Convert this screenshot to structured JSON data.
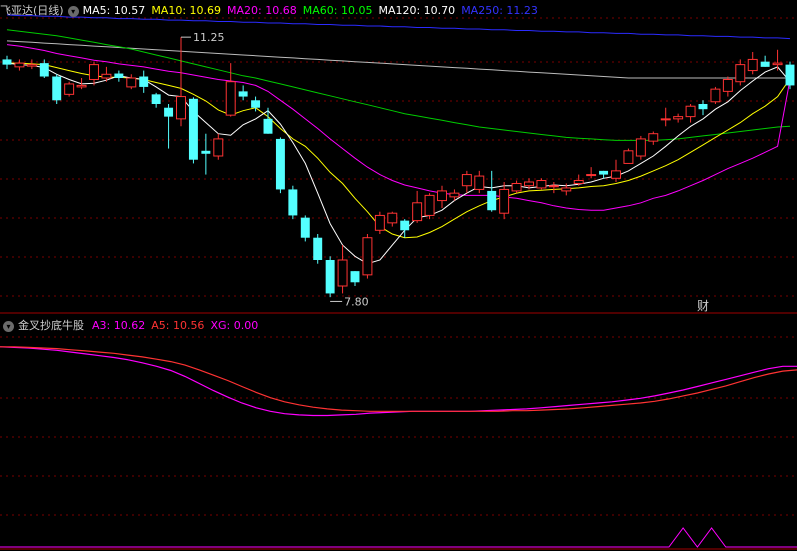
{
  "main_panel": {
    "stock_name": "飞亚达(日线)",
    "indicators": [
      {
        "label": "MA5: 10.57",
        "color": "#ffffff"
      },
      {
        "label": "MA10: 10.69",
        "color": "#ffff00"
      },
      {
        "label": "MA20: 10.68",
        "color": "#ff00ff"
      },
      {
        "label": "MA60: 10.05",
        "color": "#00ff00"
      },
      {
        "label": "MA120: 10.70",
        "color": "#ffffff"
      },
      {
        "label": "MA250: 11.23",
        "color": "#3333ff"
      }
    ],
    "high_label": "11.25",
    "low_label": "7.80",
    "finance_marker": "财"
  },
  "indicator_panel": {
    "name": "金叉抄底牛股",
    "indicators": [
      {
        "label": "A3: 10.62",
        "color": "#ff00ff"
      },
      {
        "label": "A5: 10.56",
        "color": "#ff3333"
      },
      {
        "label": "XG: 0.00",
        "color": "#ff00ff"
      }
    ]
  },
  "chart_data": [
    {
      "type": "candlestick",
      "title": "飞亚达(日线)",
      "candles": [
        [
          10.95,
          10.88,
          11.0,
          10.82
        ],
        [
          10.85,
          10.9,
          10.95,
          10.8
        ],
        [
          10.86,
          10.88,
          10.95,
          10.82
        ],
        [
          10.9,
          10.72,
          10.95,
          10.7
        ],
        [
          10.72,
          10.4,
          10.75,
          10.35
        ],
        [
          10.48,
          10.62,
          10.65,
          10.45
        ],
        [
          10.58,
          10.6,
          10.7,
          10.55
        ],
        [
          10.68,
          10.88,
          10.92,
          10.6
        ],
        [
          10.7,
          10.75,
          10.85,
          10.65
        ],
        [
          10.76,
          10.7,
          10.8,
          10.65
        ],
        [
          10.58,
          10.7,
          10.75,
          10.55
        ],
        [
          10.72,
          10.58,
          10.8,
          10.5
        ],
        [
          10.48,
          10.35,
          10.5,
          10.3
        ],
        [
          10.3,
          10.18,
          10.35,
          9.75
        ],
        [
          10.15,
          10.45,
          11.25,
          10.05
        ],
        [
          10.42,
          9.6,
          10.44,
          9.55
        ],
        [
          9.72,
          9.68,
          9.95,
          9.4
        ],
        [
          9.65,
          9.88,
          9.95,
          9.6
        ],
        [
          10.2,
          10.65,
          10.9,
          10.18
        ],
        [
          10.52,
          10.45,
          10.6,
          10.4
        ],
        [
          10.4,
          10.3,
          10.45,
          10.25
        ],
        [
          10.15,
          9.95,
          10.3,
          9.95
        ],
        [
          9.88,
          9.2,
          9.9,
          9.15
        ],
        [
          9.2,
          8.85,
          9.25,
          8.8
        ],
        [
          8.82,
          8.55,
          8.85,
          8.5
        ],
        [
          8.55,
          8.25,
          8.6,
          8.2
        ],
        [
          8.25,
          7.8,
          8.3,
          7.75
        ],
        [
          7.9,
          8.25,
          8.45,
          7.8
        ],
        [
          8.1,
          7.95,
          8.1,
          7.9
        ],
        [
          8.05,
          8.55,
          8.6,
          8.0
        ],
        [
          8.65,
          8.85,
          8.9,
          8.6
        ],
        [
          8.75,
          8.88,
          8.9,
          8.7
        ],
        [
          8.78,
          8.65,
          8.8,
          8.55
        ],
        [
          8.78,
          9.02,
          9.18,
          8.75
        ],
        [
          8.85,
          9.12,
          9.15,
          8.8
        ],
        [
          9.05,
          9.18,
          9.25,
          8.95
        ],
        [
          9.1,
          9.15,
          9.2,
          9.05
        ],
        [
          9.25,
          9.4,
          9.45,
          9.15
        ],
        [
          9.2,
          9.38,
          9.45,
          9.15
        ],
        [
          9.18,
          8.92,
          9.45,
          8.9
        ],
        [
          8.88,
          9.2,
          9.3,
          8.8
        ],
        [
          9.18,
          9.28,
          9.32,
          9.15
        ],
        [
          9.25,
          9.3,
          9.35,
          9.2
        ],
        [
          9.22,
          9.32,
          9.35,
          9.2
        ],
        [
          9.25,
          9.25,
          9.3,
          9.15
        ],
        [
          9.18,
          9.22,
          9.28,
          9.12
        ],
        [
          9.28,
          9.32,
          9.4,
          9.25
        ],
        [
          9.4,
          9.4,
          9.5,
          9.35
        ],
        [
          9.45,
          9.4,
          9.45,
          9.35
        ],
        [
          9.35,
          9.45,
          9.6,
          9.3
        ],
        [
          9.55,
          9.72,
          9.75,
          9.55
        ],
        [
          9.65,
          9.88,
          9.92,
          9.6
        ],
        [
          9.85,
          9.95,
          9.98,
          9.8
        ],
        [
          10.15,
          10.15,
          10.3,
          10.05
        ],
        [
          10.15,
          10.18,
          10.22,
          10.1
        ],
        [
          10.18,
          10.32,
          10.35,
          10.1
        ],
        [
          10.35,
          10.28,
          10.4,
          10.2
        ],
        [
          10.38,
          10.55,
          10.58,
          10.35
        ],
        [
          10.52,
          10.68,
          10.72,
          10.45
        ],
        [
          10.65,
          10.88,
          10.95,
          10.6
        ],
        [
          10.8,
          10.95,
          11.05,
          10.75
        ],
        [
          10.92,
          10.85,
          11.0,
          10.85
        ],
        [
          10.88,
          10.9,
          11.08,
          10.8
        ],
        [
          10.88,
          10.6,
          10.92,
          10.55
        ]
      ],
      "ma5": [
        10.9,
        10.88,
        10.87,
        10.84,
        10.75,
        10.68,
        10.62,
        10.63,
        10.67,
        10.73,
        10.7,
        10.68,
        10.58,
        10.47,
        10.45,
        10.25,
        10.1,
        9.95,
        9.93,
        10.07,
        10.15,
        10.26,
        10.08,
        9.83,
        9.55,
        9.15,
        8.74,
        8.45,
        8.3,
        8.2,
        8.25,
        8.45,
        8.65,
        8.82,
        8.85,
        8.92,
        9.05,
        9.15,
        9.24,
        9.22,
        9.25,
        9.25,
        9.22,
        9.24,
        9.26,
        9.25,
        9.27,
        9.3,
        9.35,
        9.38,
        9.45,
        9.55,
        9.65,
        9.78,
        9.92,
        10.05,
        10.15,
        10.28,
        10.38,
        10.53,
        10.66,
        10.78,
        10.85,
        10.65
      ],
      "ma10": [
        10.9,
        10.9,
        10.89,
        10.88,
        10.84,
        10.8,
        10.76,
        10.73,
        10.71,
        10.71,
        10.7,
        10.68,
        10.64,
        10.6,
        10.56,
        10.48,
        10.39,
        10.27,
        10.2,
        10.26,
        10.3,
        10.18,
        10.02,
        9.88,
        9.78,
        9.62,
        9.43,
        9.28,
        9.08,
        8.9,
        8.7,
        8.6,
        8.55,
        8.56,
        8.62,
        8.7,
        8.8,
        8.9,
        8.98,
        9.05,
        9.1,
        9.15,
        9.18,
        9.19,
        9.2,
        9.21,
        9.22,
        9.24,
        9.25,
        9.28,
        9.32,
        9.38,
        9.45,
        9.52,
        9.6,
        9.7,
        9.8,
        9.9,
        10.0,
        10.1,
        10.22,
        10.32,
        10.45,
        10.69
      ],
      "ma20": [
        11.15,
        11.13,
        11.1,
        11.07,
        11.03,
        11.0,
        10.97,
        10.94,
        10.92,
        10.89,
        10.87,
        10.85,
        10.82,
        10.79,
        10.77,
        10.74,
        10.71,
        10.68,
        10.66,
        10.64,
        10.6,
        10.52,
        10.4,
        10.28,
        10.15,
        10.02,
        9.88,
        9.75,
        9.62,
        9.5,
        9.4,
        9.32,
        9.26,
        9.22,
        9.18,
        9.15,
        9.13,
        9.12,
        9.12,
        9.12,
        9.1,
        9.08,
        9.05,
        9.02,
        8.98,
        8.95,
        8.93,
        8.92,
        8.92,
        8.95,
        8.98,
        9.02,
        9.08,
        9.12,
        9.18,
        9.25,
        9.32,
        9.4,
        9.48,
        9.55,
        9.62,
        9.7,
        9.78,
        10.68
      ],
      "ma60": [
        11.35,
        11.33,
        11.31,
        11.29,
        11.27,
        11.24,
        11.21,
        11.18,
        11.15,
        11.12,
        11.09,
        11.05,
        11.01,
        10.97,
        10.93,
        10.89,
        10.85,
        10.81,
        10.77,
        10.73,
        10.7,
        10.66,
        10.62,
        10.58,
        10.54,
        10.5,
        10.46,
        10.42,
        10.38,
        10.34,
        10.3,
        10.26,
        10.22,
        10.19,
        10.16,
        10.13,
        10.1,
        10.07,
        10.04,
        10.02,
        10.0,
        9.98,
        9.96,
        9.94,
        9.92,
        9.9,
        9.89,
        9.88,
        9.87,
        9.86,
        9.86,
        9.86,
        9.86,
        9.87,
        9.88,
        9.9,
        9.92,
        9.94,
        9.96,
        9.98,
        10.0,
        10.02,
        10.04,
        10.05
      ],
      "ma120": [
        11.2,
        11.19,
        11.18,
        11.17,
        11.16,
        11.15,
        11.14,
        11.13,
        11.12,
        11.11,
        11.1,
        11.09,
        11.08,
        11.07,
        11.06,
        11.05,
        11.04,
        11.03,
        11.02,
        11.01,
        11.0,
        10.99,
        10.98,
        10.97,
        10.96,
        10.95,
        10.94,
        10.93,
        10.92,
        10.91,
        10.9,
        10.89,
        10.88,
        10.87,
        10.86,
        10.85,
        10.84,
        10.83,
        10.82,
        10.81,
        10.8,
        10.79,
        10.78,
        10.77,
        10.76,
        10.75,
        10.74,
        10.73,
        10.72,
        10.71,
        10.7,
        10.7,
        10.7,
        10.7,
        10.7,
        10.7,
        10.7,
        10.7,
        10.7,
        10.7,
        10.7,
        10.7,
        10.7,
        10.7
      ],
      "ma250": [
        11.55,
        11.54,
        11.54,
        11.53,
        11.53,
        11.52,
        11.52,
        11.51,
        11.51,
        11.5,
        11.5,
        11.49,
        11.49,
        11.48,
        11.48,
        11.47,
        11.47,
        11.46,
        11.46,
        11.45,
        11.45,
        11.44,
        11.44,
        11.43,
        11.43,
        11.42,
        11.42,
        11.41,
        11.41,
        11.4,
        11.4,
        11.39,
        11.39,
        11.38,
        11.38,
        11.37,
        11.37,
        11.36,
        11.36,
        11.35,
        11.35,
        11.34,
        11.34,
        11.33,
        11.33,
        11.32,
        11.32,
        11.31,
        11.31,
        11.3,
        11.3,
        11.29,
        11.29,
        11.28,
        11.28,
        11.27,
        11.27,
        11.26,
        11.26,
        11.25,
        11.25,
        11.24,
        11.24,
        11.23
      ],
      "ylim": [
        7.55,
        11.75
      ],
      "annotations": [
        {
          "text": "11.25",
          "candle_index": 14,
          "value": 11.25
        },
        {
          "text": "7.80",
          "candle_index": 26,
          "value": 7.8
        },
        {
          "text": "财",
          "candle_index": 56
        }
      ]
    },
    {
      "type": "line",
      "title": "金叉抄底牛股",
      "series": [
        {
          "name": "A3",
          "color": "#ff00ff",
          "values": [
            10.95,
            10.94,
            10.93,
            10.91,
            10.89,
            10.86,
            10.83,
            10.8,
            10.77,
            10.73,
            10.68,
            10.62,
            10.55,
            10.45,
            10.33,
            10.21,
            10.1,
            10.0,
            9.92,
            9.86,
            9.82,
            9.8,
            9.79,
            9.79,
            9.8,
            9.81,
            9.83,
            9.84,
            9.85,
            9.86,
            9.86,
            9.86,
            9.86,
            9.86,
            9.87,
            9.88,
            9.89,
            9.9,
            9.92,
            9.94,
            9.96,
            9.98,
            10.0,
            10.02,
            10.05,
            10.08,
            10.12,
            10.17,
            10.22,
            10.28,
            10.34,
            10.4,
            10.46,
            10.52,
            10.58,
            10.62,
            10.62
          ]
        },
        {
          "name": "A5",
          "color": "#ff3333",
          "values": [
            10.95,
            10.95,
            10.94,
            10.93,
            10.92,
            10.9,
            10.88,
            10.86,
            10.84,
            10.81,
            10.78,
            10.74,
            10.7,
            10.64,
            10.56,
            10.47,
            10.38,
            10.28,
            10.18,
            10.09,
            10.02,
            9.97,
            9.93,
            9.9,
            9.88,
            9.87,
            9.86,
            9.86,
            9.86,
            9.86,
            9.86,
            9.86,
            9.86,
            9.86,
            9.86,
            9.86,
            9.87,
            9.87,
            9.88,
            9.89,
            9.9,
            9.92,
            9.94,
            9.96,
            9.98,
            10.0,
            10.03,
            10.07,
            10.12,
            10.17,
            10.23,
            10.29,
            10.36,
            10.43,
            10.49,
            10.54,
            10.56
          ]
        },
        {
          "name": "XG",
          "color": "#ff00ff",
          "values": [
            0,
            0,
            0,
            0,
            0,
            0,
            0,
            0,
            0,
            0,
            0,
            0,
            0,
            0,
            0,
            0,
            0,
            0,
            0,
            0,
            0,
            0,
            0,
            0,
            0,
            0,
            0,
            0,
            0,
            0,
            0,
            0,
            0,
            0,
            0,
            0,
            0,
            0,
            0,
            0,
            0,
            0,
            0,
            0,
            0,
            0,
            0,
            0,
            1,
            0,
            1,
            0,
            0,
            0,
            0,
            0,
            0
          ]
        }
      ],
      "ylim": [
        7.5,
        11.2
      ]
    }
  ]
}
